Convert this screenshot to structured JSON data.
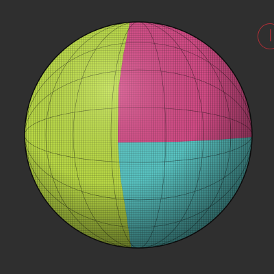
{
  "viewport": {
    "background_color": "#2f2f2f"
  },
  "sphere": {
    "polygroups": [
      {
        "name": "",
        "color": "#c6e84a",
        "region": "left-half"
      },
      {
        "name": "",
        "color": "#e0508e",
        "region": "upper-right-quarter"
      },
      {
        "name": "",
        "color": "#5fd1cf",
        "region": "lower-right-quarter"
      }
    ],
    "wireframe_visible": true,
    "wireframe_color": "#111111"
  },
  "gizmo": {
    "icon": "orientation-gizmo-icon",
    "color": "#b12e36"
  }
}
